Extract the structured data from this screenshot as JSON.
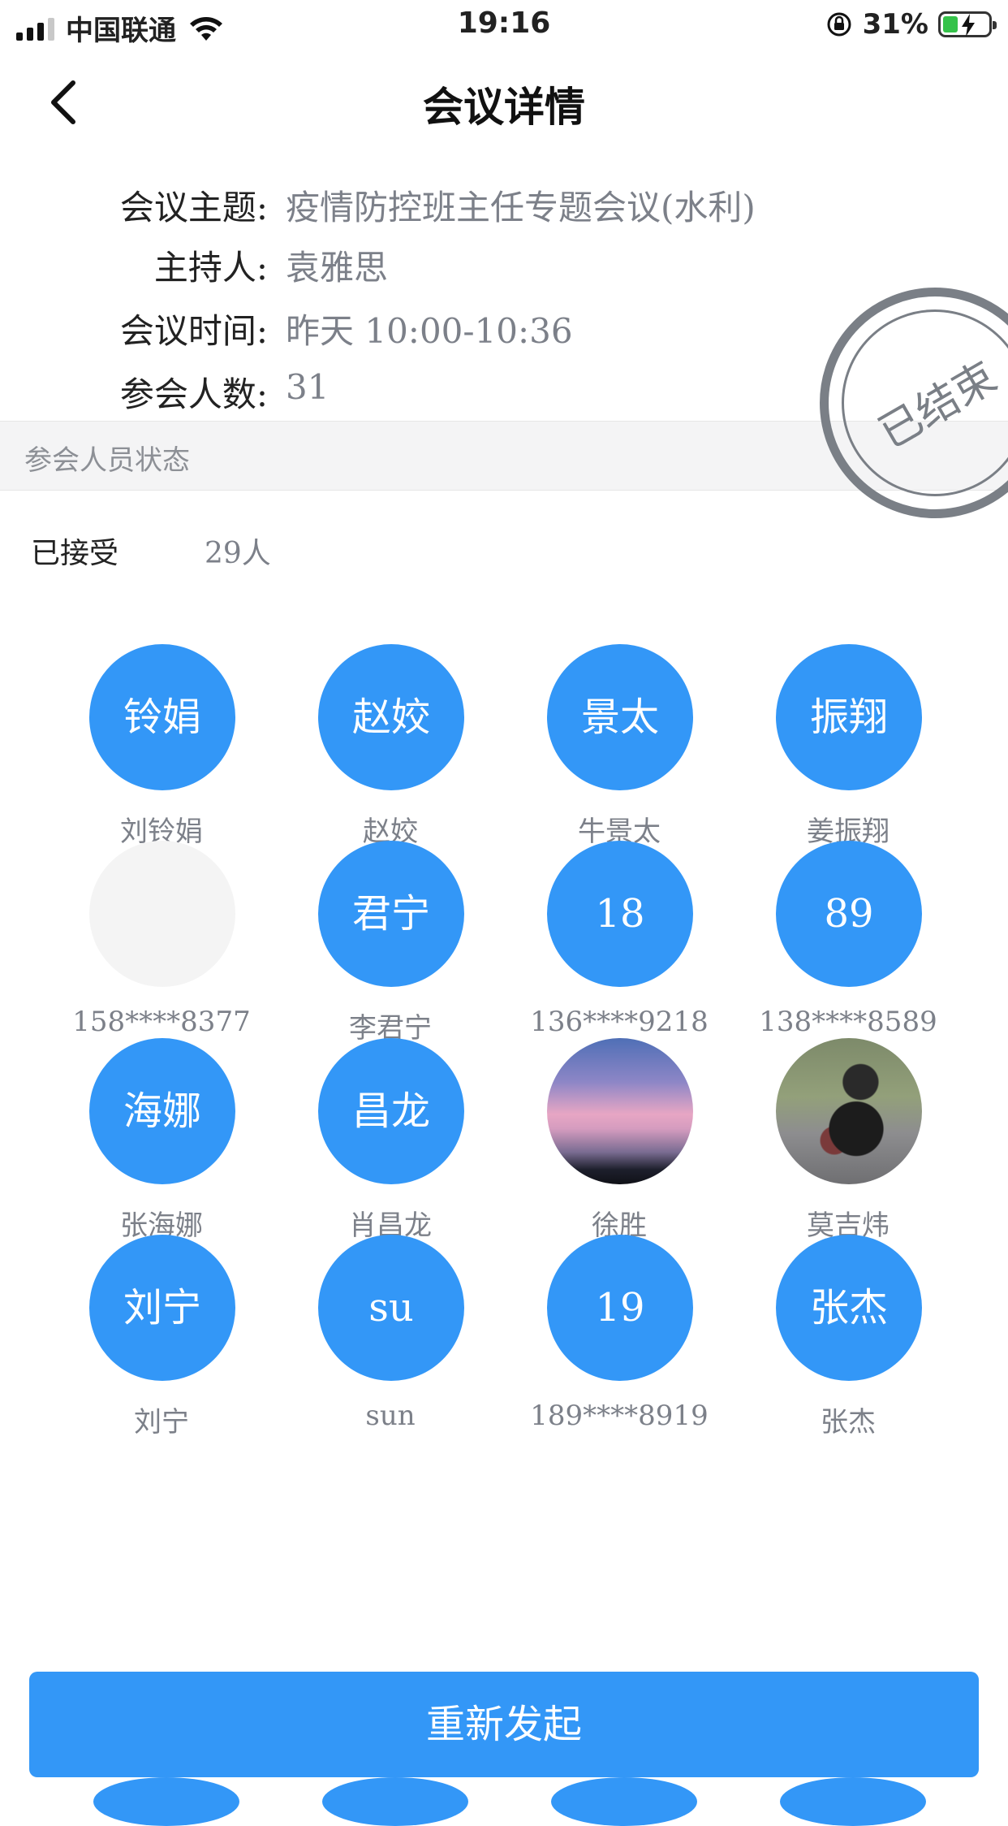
{
  "status_bar": {
    "carrier": "中国联通",
    "time": "19:16",
    "battery": "31%"
  },
  "nav": {
    "title": "会议详情"
  },
  "meeting": {
    "topic_label": "会议主题:",
    "topic": "疫情防控班主任专题会议(水利)",
    "host_label": "主持人:",
    "host": "袁雅思",
    "time_label": "会议时间:",
    "time": "昨天  10:00-10:36",
    "count_label": "参会人数:",
    "count": "31",
    "stamp": "已结束"
  },
  "section": {
    "title": "参会人员状态",
    "accepted_label": "已接受",
    "accepted_count": "29人"
  },
  "members": [
    {
      "avatar_text": "铃娟",
      "name": "刘铃娟",
      "type": "text"
    },
    {
      "avatar_text": "赵姣",
      "name": "赵姣",
      "type": "text"
    },
    {
      "avatar_text": "景太",
      "name": "牛景太",
      "type": "text"
    },
    {
      "avatar_text": "振翔",
      "name": "姜振翔",
      "type": "text"
    },
    {
      "avatar_text": "",
      "name": "158****8377",
      "type": "empty"
    },
    {
      "avatar_text": "君宁",
      "name": "李君宁",
      "type": "text"
    },
    {
      "avatar_text": "18",
      "name": "136****9218",
      "type": "text"
    },
    {
      "avatar_text": "89",
      "name": "138****8589",
      "type": "text"
    },
    {
      "avatar_text": "海娜",
      "name": "张海娜",
      "type": "text"
    },
    {
      "avatar_text": "昌龙",
      "name": "肖昌龙",
      "type": "text"
    },
    {
      "avatar_text": "",
      "name": "徐胜",
      "type": "photo-sky"
    },
    {
      "avatar_text": "",
      "name": "莫吉炜",
      "type": "photo-person"
    },
    {
      "avatar_text": "刘宁",
      "name": "刘宁",
      "type": "text"
    },
    {
      "avatar_text": "su",
      "name": "sun",
      "type": "text"
    },
    {
      "avatar_text": "19",
      "name": "189****8919",
      "type": "text"
    },
    {
      "avatar_text": "张杰",
      "name": "张杰",
      "type": "text"
    }
  ],
  "footer": {
    "button_label": "重新发起"
  },
  "colors": {
    "accent": "#3397f7",
    "stamp": "#7a7f86",
    "muted_text": "#7c8089"
  }
}
